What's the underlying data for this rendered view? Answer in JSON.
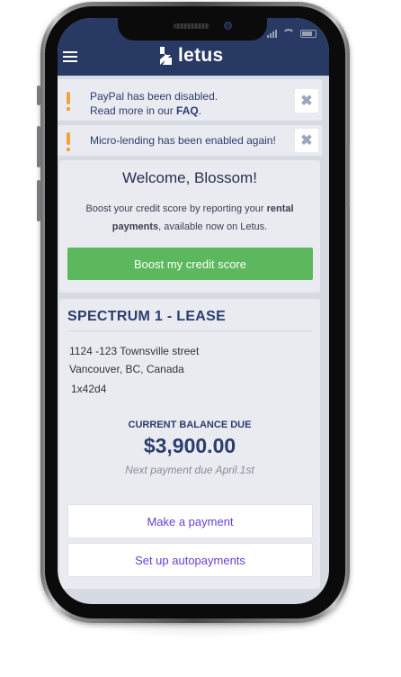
{
  "app": {
    "logo_text": "letus"
  },
  "alerts": [
    {
      "line1": "PayPal has been disabled.",
      "line2_prefix": "Read more in our ",
      "line2_link": "FAQ",
      "line2_suffix": ".",
      "close": "✖"
    },
    {
      "line1": "Micro-lending has been enabled again!",
      "close": "✖"
    }
  ],
  "welcome": {
    "greeting": "Welcome, ",
    "name": "Blossom",
    "exclaim": "!",
    "body_1": "Boost your credit score by reporting your ",
    "body_bold": "rental payments",
    "body_2": ", available now on Letus.",
    "cta": "Boost my credit score"
  },
  "lease": {
    "title": "SPECTRUM 1 - LEASE",
    "address_line1": "1124 -123 Townsville street",
    "address_line2": "Vancouver, BC, Canada",
    "address_line3": "1x42d4",
    "balance_label": "CURRENT BALANCE DUE",
    "balance_amount": "$3,900.00",
    "next_due": "Next payment due April.1st",
    "pay_button": "Make a payment",
    "autopay_button": "Set up autopayments"
  },
  "colors": {
    "header": "#283a64",
    "accent_green": "#5cb85c",
    "link_purple": "#6a3fd0",
    "warning_orange": "#f1a23a"
  }
}
